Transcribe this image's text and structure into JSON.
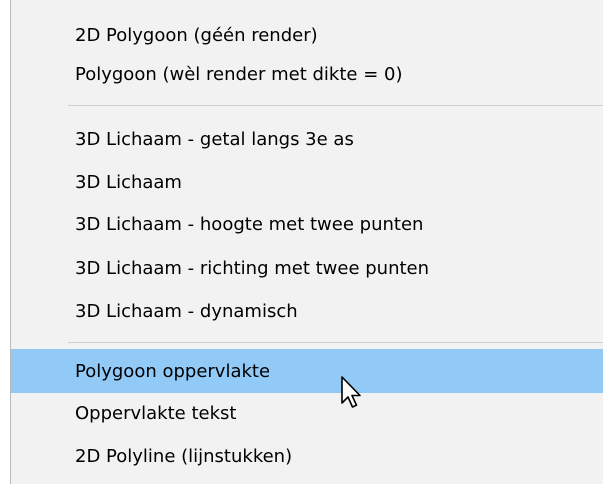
{
  "menu": {
    "items": [
      {
        "label": "2D Polygoon (géén render)"
      },
      {
        "label": "Polygoon (wèl render met dikte = 0)"
      },
      {
        "label": "3D Lichaam - getal langs 3e as"
      },
      {
        "label": "3D Lichaam"
      },
      {
        "label": "3D Lichaam - hoogte met twee punten"
      },
      {
        "label": "3D Lichaam - richting met twee punten"
      },
      {
        "label": "3D Lichaam - dynamisch"
      },
      {
        "label": "Polygoon oppervlakte"
      },
      {
        "label": "Oppervlakte tekst"
      },
      {
        "label": "2D Polyline (lijnstukken)"
      }
    ],
    "selected_item": "Polygoon oppervlakte"
  },
  "colors": {
    "menu_background": "#f2f2f2",
    "selected_background": "#91c9f7",
    "separator": "#cfcfcf",
    "text": "#000000"
  },
  "icons": {
    "cursor": "mouse-pointer-icon"
  }
}
